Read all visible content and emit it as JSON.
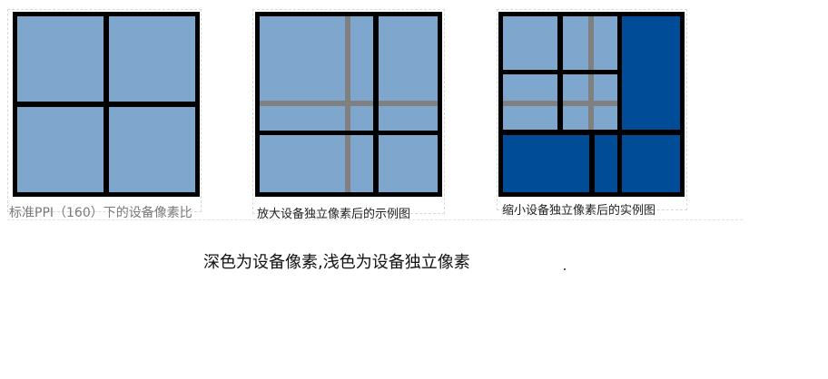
{
  "captions": {
    "standard": "标准PPI（160）下的设备像素比",
    "enlarged": "放大设备独立像素后的示例图",
    "shrunk": "缩小设备独立像素后的实例图"
  },
  "note": "深色为设备像素,浅色为设备独立像素",
  "colors": {
    "light_pixel": "#7fa6cd",
    "dark_pixel": "#004c97",
    "grid_line": "#000000",
    "independent_line": "#808080"
  }
}
